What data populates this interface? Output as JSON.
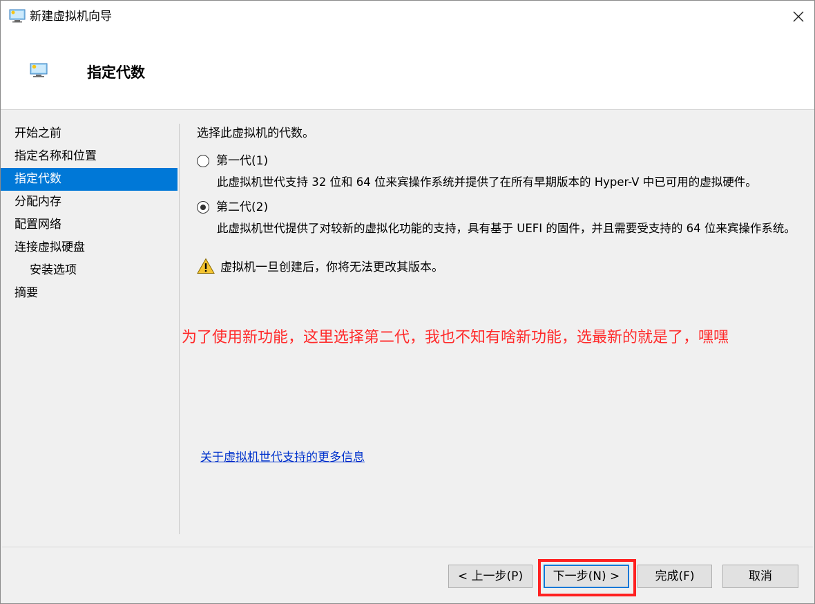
{
  "window": {
    "title": "新建虚拟机向导",
    "close_glyph": "✕"
  },
  "header": {
    "title": "指定代数"
  },
  "nav": {
    "items": [
      {
        "label": "开始之前"
      },
      {
        "label": "指定名称和位置"
      },
      {
        "label": "指定代数"
      },
      {
        "label": "分配内存"
      },
      {
        "label": "配置网络"
      },
      {
        "label": "连接虚拟硬盘"
      },
      {
        "label": "安装选项"
      },
      {
        "label": "摘要"
      }
    ],
    "active_index": 2
  },
  "content": {
    "prompt": "选择此虚拟机的代数。",
    "gen1": {
      "label": "第一代(1)",
      "description": "此虚拟机世代支持 32 位和 64 位来宾操作系统并提供了在所有早期版本的 Hyper-V 中已可用的虚拟硬件。",
      "selected": false
    },
    "gen2": {
      "label": "第二代(2)",
      "description": "此虚拟机世代提供了对较新的虚拟化功能的支持，具有基于 UEFI 的固件，并且需要受支持的 64 位来宾操作系统。",
      "selected": true
    },
    "warning": "虚拟机一旦创建后，你将无法更改其版本。",
    "annotation": "为了使用新功能，这里选择第二代，我也不知有啥新功能，选最新的就是了，嘿嘿",
    "more_info_link": "关于虚拟机世代支持的更多信息"
  },
  "footer": {
    "prev_label": "< 上一步(P)",
    "next_label": "下一步(N) >",
    "finish_label": "完成(F)",
    "cancel_label": "取消"
  },
  "colors": {
    "accent": "#0078d7",
    "annotation": "#ff2a2a",
    "highlight_box": "#ff2020",
    "link": "#0033cc"
  }
}
